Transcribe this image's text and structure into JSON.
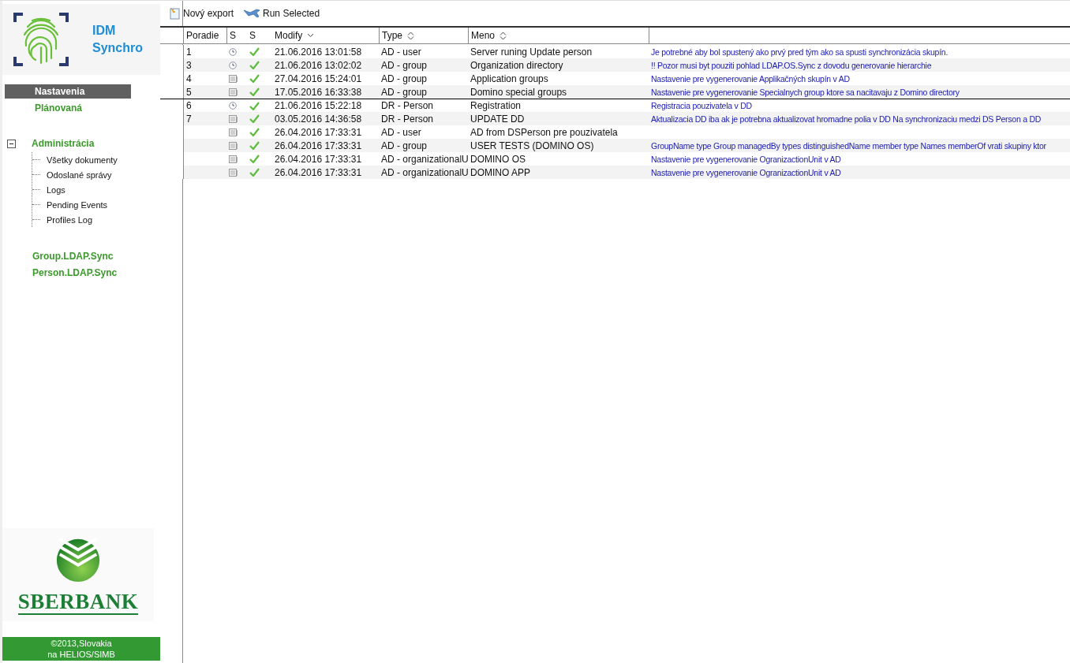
{
  "logo": {
    "line_1": "IDM",
    "line_2": "Synchro"
  },
  "sidebar": {
    "items": [
      {
        "label": "Nastavenia",
        "selected": true
      },
      {
        "label": "Plánovaná",
        "selected": false
      }
    ],
    "tree": {
      "label": "Administrácia",
      "expanded": true,
      "children": [
        {
          "label": "Všetky dokumenty"
        },
        {
          "label": "Odoslané správy"
        },
        {
          "label": "Logs"
        },
        {
          "label": "Pending Events"
        },
        {
          "label": "Profiles Log"
        }
      ]
    },
    "links": [
      {
        "label": "Group.LDAP.Sync"
      },
      {
        "label": "Person.LDAP.Sync"
      }
    ],
    "brand": "SBERBANK",
    "footer": [
      "©2013,Slovakia",
      "na HELIOS/SIMB"
    ]
  },
  "toolbar": [
    {
      "kind": "new",
      "label": "Nový export"
    },
    {
      "kind": "run",
      "label": "Run Selected"
    }
  ],
  "table": {
    "columns": [
      {
        "label": "Poradie",
        "kind": "plain"
      },
      {
        "label": "S",
        "kind": "plain"
      },
      {
        "label": "S",
        "kind": "plain"
      },
      {
        "label": "Modify",
        "kind": "sorted"
      },
      {
        "label": "Type",
        "kind": "sortable"
      },
      {
        "label": "Meno",
        "kind": "sortable"
      }
    ],
    "rows": [
      {
        "order": "1",
        "kind": "clock",
        "ok": true,
        "modify": "21.06.2016 13:01:58",
        "type": "AD - user",
        "name": "Server runing Update person",
        "description": "Je potrebné aby bol spustený ako prvý pred tým ako sa spusti synchronizácia skupín.",
        "selected": false
      },
      {
        "order": "3",
        "kind": "clock",
        "ok": true,
        "modify": "21.06.2016 13:02:02",
        "type": "AD - group",
        "name": "Organization directory",
        "description": "!! Pozor musi byt pouziti pohlad LDAP.OS.Sync z dovodu generovanie hierarchie",
        "selected": false
      },
      {
        "order": "4",
        "kind": "document",
        "ok": true,
        "modify": "27.04.2016 15:24:01",
        "type": "AD - group",
        "name": "Application groups",
        "description": "Nastavenie pre vygenerovanie Applikačných skupín v AD",
        "selected": false
      },
      {
        "order": "5",
        "kind": "document",
        "ok": true,
        "modify": "17.05.2016 16:33:38",
        "type": "AD - group",
        "name": "Domino special groups",
        "description": "Nastavenie pre vygenerovanie Specialnych group ktore sa nacitavaju z Domino directory",
        "selected": false
      },
      {
        "order": "6",
        "kind": "clock",
        "ok": true,
        "modify": "21.06.2016 15:22:18",
        "type": "DR - Person",
        "name": "Registration",
        "description": "Registracia pouzivatela v DD",
        "selected": true
      },
      {
        "order": "7",
        "kind": "document",
        "ok": true,
        "modify": "03.05.2016 14:36:58",
        "type": "DR - Person",
        "name": "UPDATE DD",
        "description": "Aktualizacia DD iba ak je potrebna aktualizovat hromadne polia v DD Na synchronizaciu medzi DS Person a DD",
        "selected": false
      },
      {
        "kind": "document",
        "ok": true,
        "modify": "26.04.2016 17:33:31",
        "type": "AD - user",
        "name": "AD from DSPerson pre pouzivatela",
        "selected": false
      },
      {
        "kind": "document",
        "ok": true,
        "modify": "26.04.2016 17:33:31",
        "type": "AD - group",
        "name": "USER TESTS (DOMINO OS)",
        "description": "GroupName type Group managedBy types distinguishedName member type Names memberOf  vrati skupiny ktor",
        "selected": false
      },
      {
        "kind": "document",
        "ok": true,
        "modify": "26.04.2016 17:33:31",
        "type": "AD - organizationalU",
        "name": "DOMINO OS",
        "description": "Nastavenie pre vygenerovanie OgranizactionUnit v AD",
        "selected": false
      },
      {
        "kind": "document",
        "ok": true,
        "modify": "26.04.2016 17:33:31",
        "type": "AD - organizationalU",
        "name": "DOMINO APP",
        "description": "Nastavenie pre vygenerovanie OgranizactionUnit v AD",
        "selected": false
      }
    ]
  }
}
